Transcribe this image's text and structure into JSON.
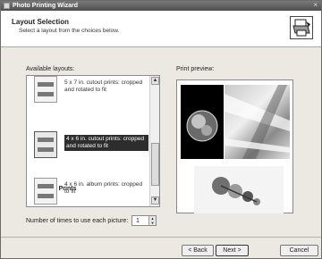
{
  "window": {
    "title": "Photo Printing Wizard",
    "close_glyph": "×"
  },
  "header": {
    "title": "Layout Selection",
    "subtitle": "Select a layout from the choices below.",
    "icon": "printer-icon"
  },
  "layouts": {
    "label": "Available layouts:",
    "items": [
      {
        "text": "5 x 7 in. cutout prints: cropped and rotated to fit",
        "selected": false
      },
      {
        "text": "4 x 6 in. cutout prints: cropped and rotated to fit",
        "selected": true
      },
      {
        "text": "4 x 6 in. album prints: cropped to fit",
        "selected": false
      }
    ],
    "group_heading": "4 x 6 in. Prints"
  },
  "preview": {
    "label": "Print preview:"
  },
  "copies": {
    "label": "Number of times to use each picture:",
    "value": "1"
  },
  "buttons": {
    "back": "< Back",
    "next": "Next >",
    "cancel": "Cancel"
  },
  "colors": {
    "selection": "#2d2d2d",
    "dialog_bg": "#ece9e2"
  }
}
